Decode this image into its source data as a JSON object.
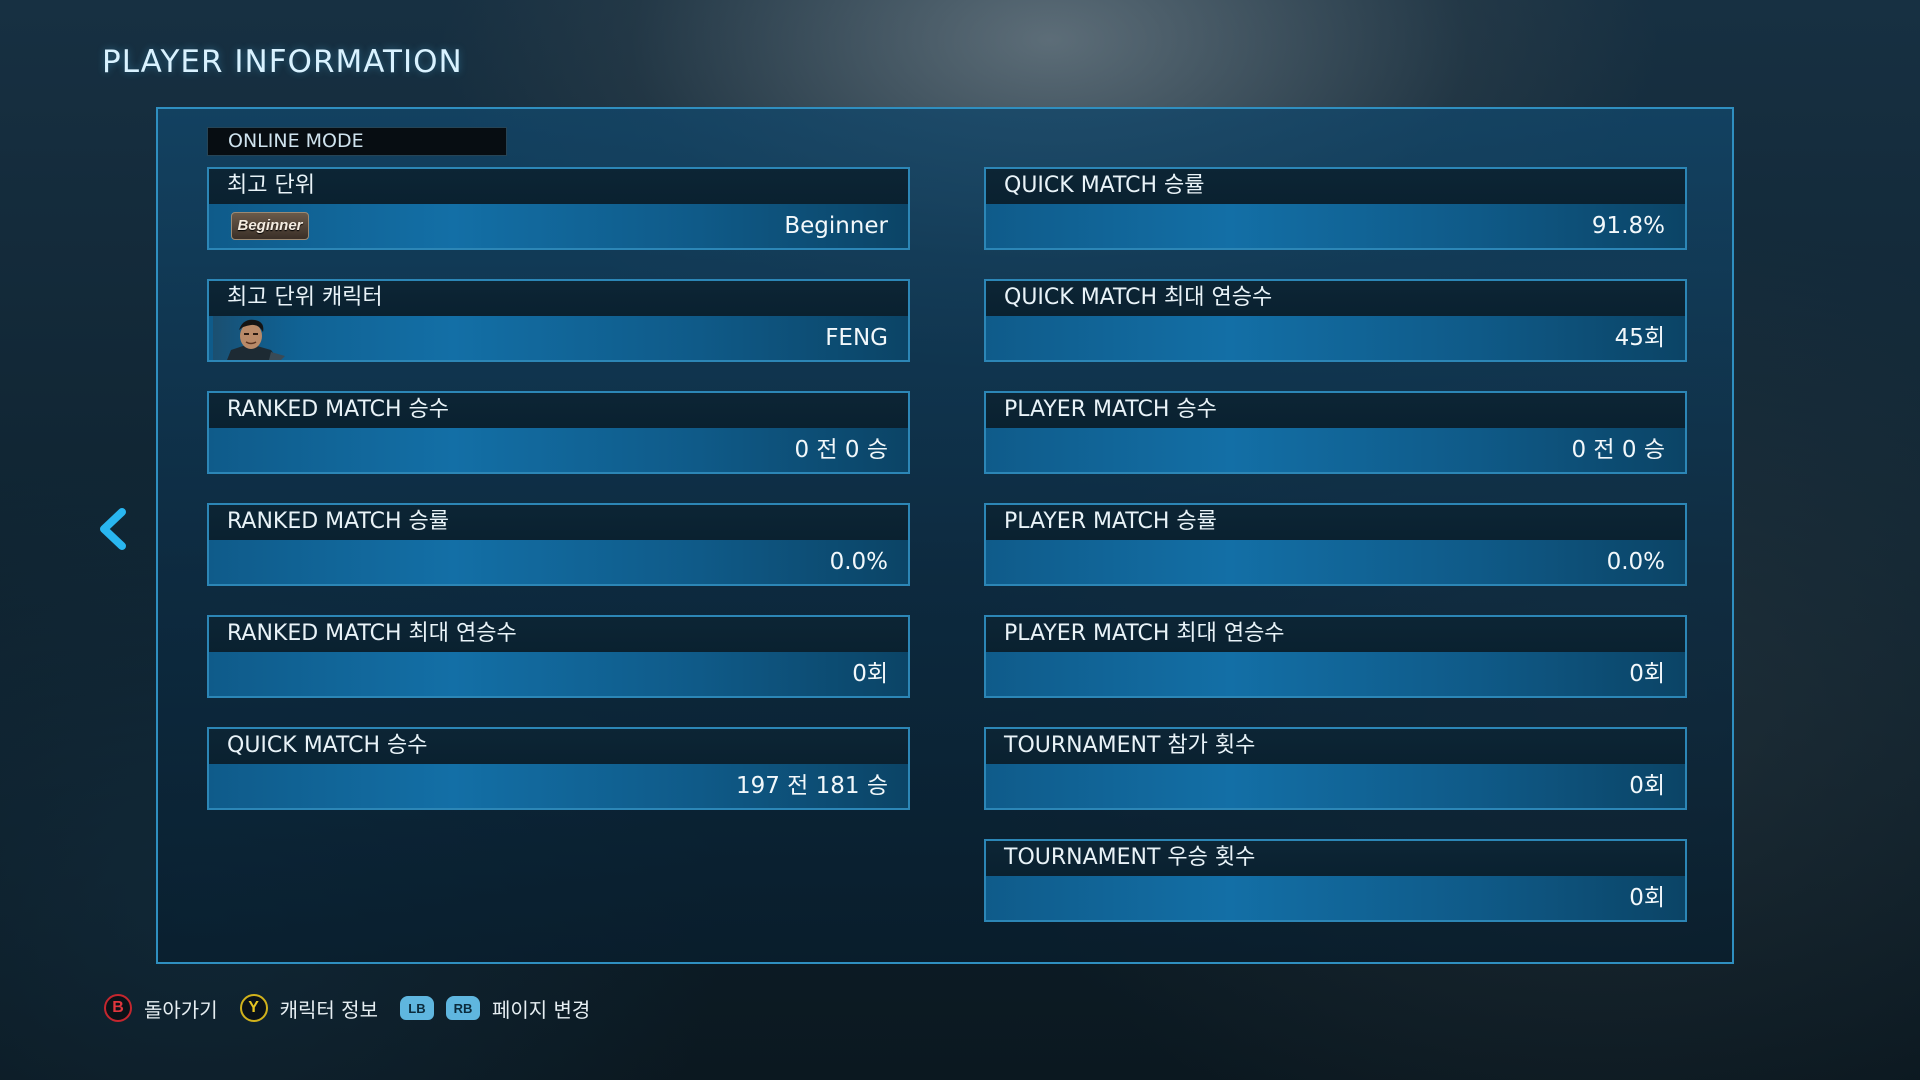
{
  "header": {
    "title": "PLAYER INFORMATION"
  },
  "section": {
    "mode_label": "ONLINE MODE"
  },
  "left_cards": [
    {
      "label": "최고 단위",
      "value": "Beginner",
      "badge": "Beginner"
    },
    {
      "label": "최고 단위 캐릭터",
      "value": "FENG"
    },
    {
      "label": "RANKED MATCH 승수",
      "value": "0 전 0 승"
    },
    {
      "label": "RANKED MATCH 승률",
      "value": "0.0%"
    },
    {
      "label": "RANKED MATCH 최대 연승수",
      "value": "0회"
    },
    {
      "label": "QUICK MATCH 승수",
      "value": "197 전 181 승"
    }
  ],
  "right_cards": [
    {
      "label": "QUICK MATCH 승률",
      "value": "91.8%"
    },
    {
      "label": "QUICK MATCH 최대 연승수",
      "value": "45회"
    },
    {
      "label": "PLAYER MATCH 승수",
      "value": "0 전 0 승"
    },
    {
      "label": "PLAYER MATCH 승률",
      "value": "0.0%"
    },
    {
      "label": "PLAYER MATCH 최대 연승수",
      "value": "0회"
    },
    {
      "label": "TOURNAMENT 참가 횟수",
      "value": "0회"
    },
    {
      "label": "TOURNAMENT 우승 횟수",
      "value": "0회"
    }
  ],
  "footer": {
    "back_key": "B",
    "back_label": "돌아가기",
    "char_info_key": "Y",
    "char_info_label": "캐릭터 정보",
    "lb_key": "LB",
    "rb_key": "RB",
    "page_change_label": "페이지 변경"
  },
  "icons": {
    "nav_prev": "chevron-left-icon",
    "rank": "rank-badge-icon",
    "character": "character-portrait-icon"
  },
  "colors": {
    "accent": "#2f8fc0",
    "value_bar": "#136fa6",
    "chevron": "#29b6f0",
    "button_b": "#c4262e",
    "button_y": "#d1b21c",
    "bumper": "#5fb6df"
  }
}
